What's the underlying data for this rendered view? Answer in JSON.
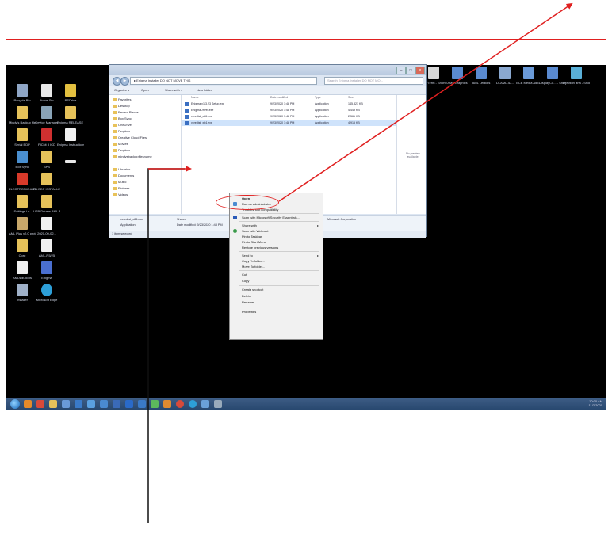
{
  "desktop_left_icons": [
    [
      "Recycle Bin",
      "Acme Sw",
      "PSDrive"
    ],
    [
      "Mindy's Backup files",
      "Device Manager",
      "Enigma RELEASE fil..."
    ],
    [
      "Serial BDP",
      "PICkit 3 ICD",
      "Enigma Instructions"
    ],
    [
      "Box Sync",
      "SPS",
      ""
    ],
    [
      "ELECTRONIC ARTS INSTALL",
      "EA BDP INSTALLER",
      ""
    ],
    [
      "Settings i.e.",
      "USB Drivers AML 35S",
      ""
    ],
    [
      "AML Plus v2.0 protocols",
      "2020-09-02...",
      ""
    ],
    [
      "Corp",
      "AML-R5/25",
      ""
    ],
    [
      "AMLsolutions",
      "Enigma",
      ""
    ],
    [
      "Installer",
      "Microsoft Edge",
      ""
    ]
  ],
  "desktop_top_icons": [
    "AML-R60...",
    "AML-R125...",
    "AML-R60-R...",
    "AML-R125...",
    "AML Ru Configurat...",
    "Studio Graphs",
    "ClearTerm - Shortcut",
    "AML Graphics",
    "AML Lerlicks",
    "DLAML-ID...",
    "ECE Media Add...",
    "DisplayCo... - Shortcut",
    "Injection ana - Shortcut"
  ],
  "explorer": {
    "path": "▸ Enigma Installer DO NOT MOVE THIS",
    "search": "Search Enigma Installer DO NOT MO...",
    "toolbar": [
      "Organize ▾",
      "Open",
      "Share with ▾",
      "New folder"
    ],
    "nav": [
      "Favorites",
      "Desktop",
      "Recent Places",
      "Box Sync",
      "OneDrive",
      "Dropbox",
      "Creative Cloud Files",
      "Movies",
      "Dropbox",
      "mindysbackupfilesname",
      "Libraries",
      "Documents",
      "Music",
      "Pictures",
      "Videos"
    ],
    "columns": [
      "Name",
      "Date modified",
      "Type",
      "Size"
    ],
    "files": [
      {
        "name": "Enigma v1.3.23 Setup.exe",
        "date": "9/23/2020 1:48 PM",
        "type": "Application",
        "size": "145,821 KB"
      },
      {
        "name": "EnigmaDriver.exe",
        "date": "9/23/2020 1:48 PM",
        "type": "Application",
        "size": "4,449 KB"
      },
      {
        "name": "vcredist_x86.exe",
        "date": "9/23/2020 1:48 PM",
        "type": "Application",
        "size": "2,561 KB"
      },
      {
        "name": "vcredist_x64.exe",
        "date": "9/23/2020 1:48 PM",
        "type": "Application",
        "size": "4,915 KB"
      }
    ],
    "preview": "No preview available.",
    "details": {
      "name": "vcredist_x86.exe",
      "kind": "Application",
      "state": "Shared",
      "modified": "Date modified: 9/23/2020 1:48 PM",
      "size": "Size: 2.50 MB",
      "company": "Microsoft Corporation"
    },
    "status": "1 item selected"
  },
  "context_menu": [
    "Open",
    "Run as administrator",
    "Troubleshoot compatibility",
    "Scan with Microsoft Security Essentials...",
    "Share with",
    "Scan with Webroot",
    "Pin to Taskbar",
    "Pin to Start Menu",
    "Restore previous versions",
    "Send to",
    "Copy To folder...",
    "Move To folder...",
    "Cut",
    "Copy",
    "Create shortcut",
    "Delete",
    "Rename",
    "Properties"
  ],
  "clock": {
    "time": "10:00 AM",
    "date": "11/2/2020"
  },
  "colors": {
    "annotation": "#e02020",
    "desktop": "#000000",
    "taskbar": "#2f4f79"
  }
}
